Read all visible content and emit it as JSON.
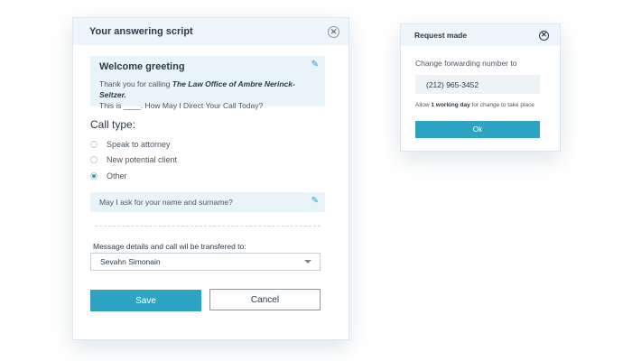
{
  "script_panel": {
    "title": "Your answering script",
    "greeting": {
      "title": "Welcome greeting",
      "line1_prefix": "Thank you for calling ",
      "firm_name": "The Law Office of Ambre Nerinck-Seltzer.",
      "line2": "This is ____. How May I Direct Your Call Today?"
    },
    "call_type": {
      "title": "Call type:",
      "options": [
        {
          "label": "Speak to attorney",
          "selected": false
        },
        {
          "label": "New potential client",
          "selected": false
        },
        {
          "label": "Other",
          "selected": true
        }
      ]
    },
    "question": "May I ask for your name and surname?",
    "transfer": {
      "label": "Message details and call wil  be transfered to:",
      "selected": "Sevahn Simonain"
    },
    "save_label": "Save",
    "cancel_label": "Cancel"
  },
  "request_panel": {
    "title": "Request made",
    "forward_label": "Change forwarding number to",
    "phone": "(212) 965-3452",
    "note_prefix": "Allow ",
    "note_bold": "1 working day",
    "note_suffix": " for change to take place",
    "ok_label": "Ok"
  },
  "icons": {
    "close": "close-icon",
    "edit": "pencil-icon",
    "dropdown": "chevron-down-icon"
  },
  "colors": {
    "accent": "#2ea3c2",
    "header_bg": "#eef6fb",
    "box_bg": "#e9f4fa"
  }
}
